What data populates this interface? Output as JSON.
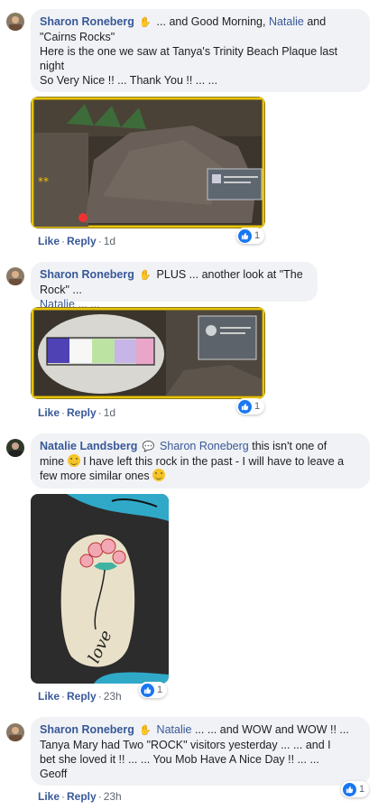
{
  "comments": [
    {
      "author": "Sharon Roneberg",
      "text_before_mention": "... and Good Morning,",
      "mention": "Natalie",
      "line1_end": "and",
      "line2": "\"Cairns Rocks\"",
      "line3": "Here is the one we saw at Tanya's Trinity Beach Plaque last",
      "line4": "night",
      "line5": "So Very Nice !! ... Thank You !! ... ...",
      "like_label": "Like",
      "reply_label": "Reply",
      "time": "1d",
      "reaction_count": "1"
    },
    {
      "author": "Sharon Roneberg",
      "line1_text": "PLUS ... another look at \"The Rock\" ...",
      "mention": "Natalie",
      "line2_text": "... ...",
      "like_label": "Like",
      "reply_label": "Reply",
      "time": "1d",
      "reaction_count": "1"
    },
    {
      "author": "Natalie Landsberg",
      "tagged": "Sharon Roneberg",
      "line1_text": "this isn't one of",
      "line2_start": "mine",
      "line2_end": "I have left this rock in the past - I will have to leave a",
      "line3_text": "few more similar ones",
      "like_label": "Like",
      "reply_label": "Reply",
      "time": "23h",
      "reaction_count": "1",
      "rock_text": "love"
    },
    {
      "author": "Sharon Roneberg",
      "mention": "Natalie",
      "line1_text": "... ... and WOW and WOW !! ...",
      "line2": "Tanya Mary had Two \"ROCK\" visitors yesterday ... ... and I",
      "line3": "bet she loved it !! ... ... You Mob Have A Nice Day !! ... ...",
      "line4": "Geoff",
      "like_label": "Like",
      "reply_label": "Reply",
      "time": "23h",
      "reaction_count": "1"
    }
  ],
  "colors": {
    "link": "#385898",
    "bubble": "#f0f2f5",
    "like_blue": "#1877f2",
    "photo_frame": "#e8c40a"
  }
}
